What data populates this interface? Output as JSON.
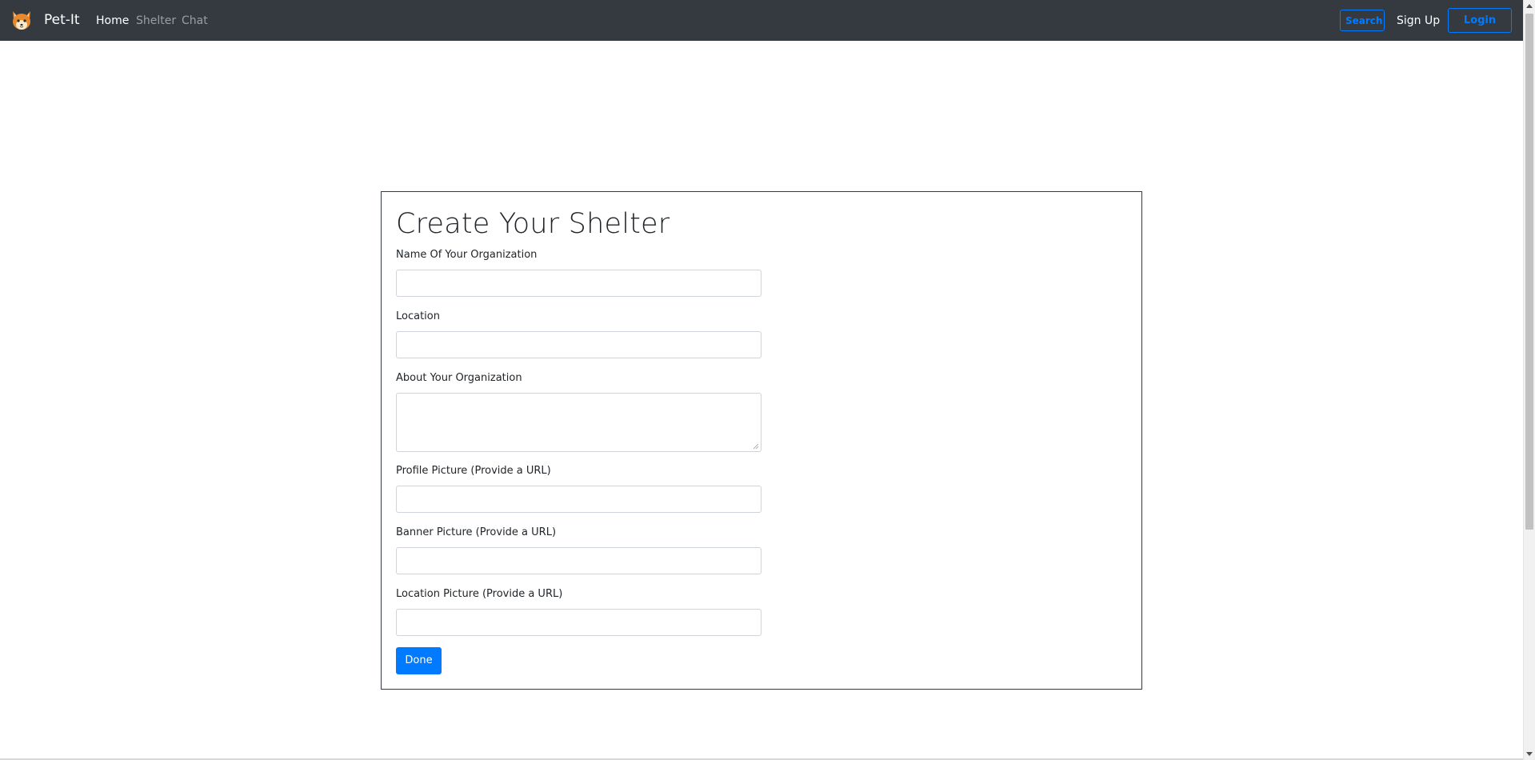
{
  "navbar": {
    "brand_name": "Pet-It",
    "logo_icon": "fox-icon",
    "links": [
      {
        "label": "Home",
        "active": true
      },
      {
        "label": "Shelter",
        "active": false
      },
      {
        "label": "Chat",
        "active": false
      }
    ],
    "search_label": "Search",
    "signup_label": "Sign Up",
    "login_label": "Login"
  },
  "form": {
    "title": "Create Your Shelter",
    "fields": [
      {
        "label": "Name Of Your Organization",
        "type": "input",
        "value": ""
      },
      {
        "label": "Location",
        "type": "input",
        "value": ""
      },
      {
        "label": "About Your Organization",
        "type": "textarea",
        "value": ""
      },
      {
        "label": "Profile Picture (Provide a URL)",
        "type": "input",
        "value": ""
      },
      {
        "label": "Banner Picture (Provide a URL)",
        "type": "input",
        "value": ""
      },
      {
        "label": "Location Picture (Provide a URL)",
        "type": "input",
        "value": ""
      }
    ],
    "submit_label": "Done"
  },
  "colors": {
    "navbar_bg": "#343a40",
    "primary": "#007bff",
    "card_border": "#343a40"
  }
}
